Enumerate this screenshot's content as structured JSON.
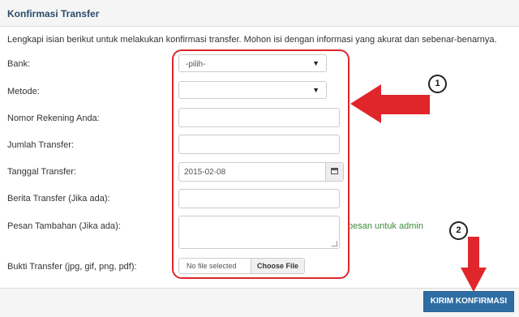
{
  "panel": {
    "title": "Konfirmasi Transfer"
  },
  "intro": "Lengkapi isian berikut untuk melakukan konfirmasi transfer. Mohon isi dengan informasi yang akurat dan sebenar-benarnya.",
  "form": {
    "bank": {
      "label": "Bank:",
      "value": "-pilih-"
    },
    "metode": {
      "label": "Metode:",
      "value": ""
    },
    "nomor_rekening": {
      "label": "Nomor Rekening Anda:",
      "value": ""
    },
    "jumlah_transfer": {
      "label": "Jumlah Transfer:",
      "value": ""
    },
    "tanggal_transfer": {
      "label": "Tanggal Transfer:",
      "value": "2015-02-08"
    },
    "berita_transfer": {
      "label": "Berita Transfer (Jika ada):",
      "value": ""
    },
    "pesan_tambahan": {
      "label": "Pesan Tambahan (Jika ada):",
      "value": "",
      "note": "pesan untuk admin"
    },
    "bukti_transfer": {
      "label": "Bukti Transfer (jpg, gif, png, pdf):",
      "status": "No file selected",
      "button": "Choose File"
    }
  },
  "submit": {
    "label": "KIRIM KONFIRMASI"
  },
  "annotations": {
    "marker_1": "1",
    "marker_2": "2"
  },
  "colors": {
    "title": "#2b4a6b",
    "primary_button": "#2e6da4",
    "annotation_red": "#e0262b",
    "note_green": "#3c8b3c"
  },
  "icons": {
    "date_picker": "calendar-icon",
    "select_caret": "caret-down-icon",
    "annotation_arrow": "arrow-icon"
  }
}
